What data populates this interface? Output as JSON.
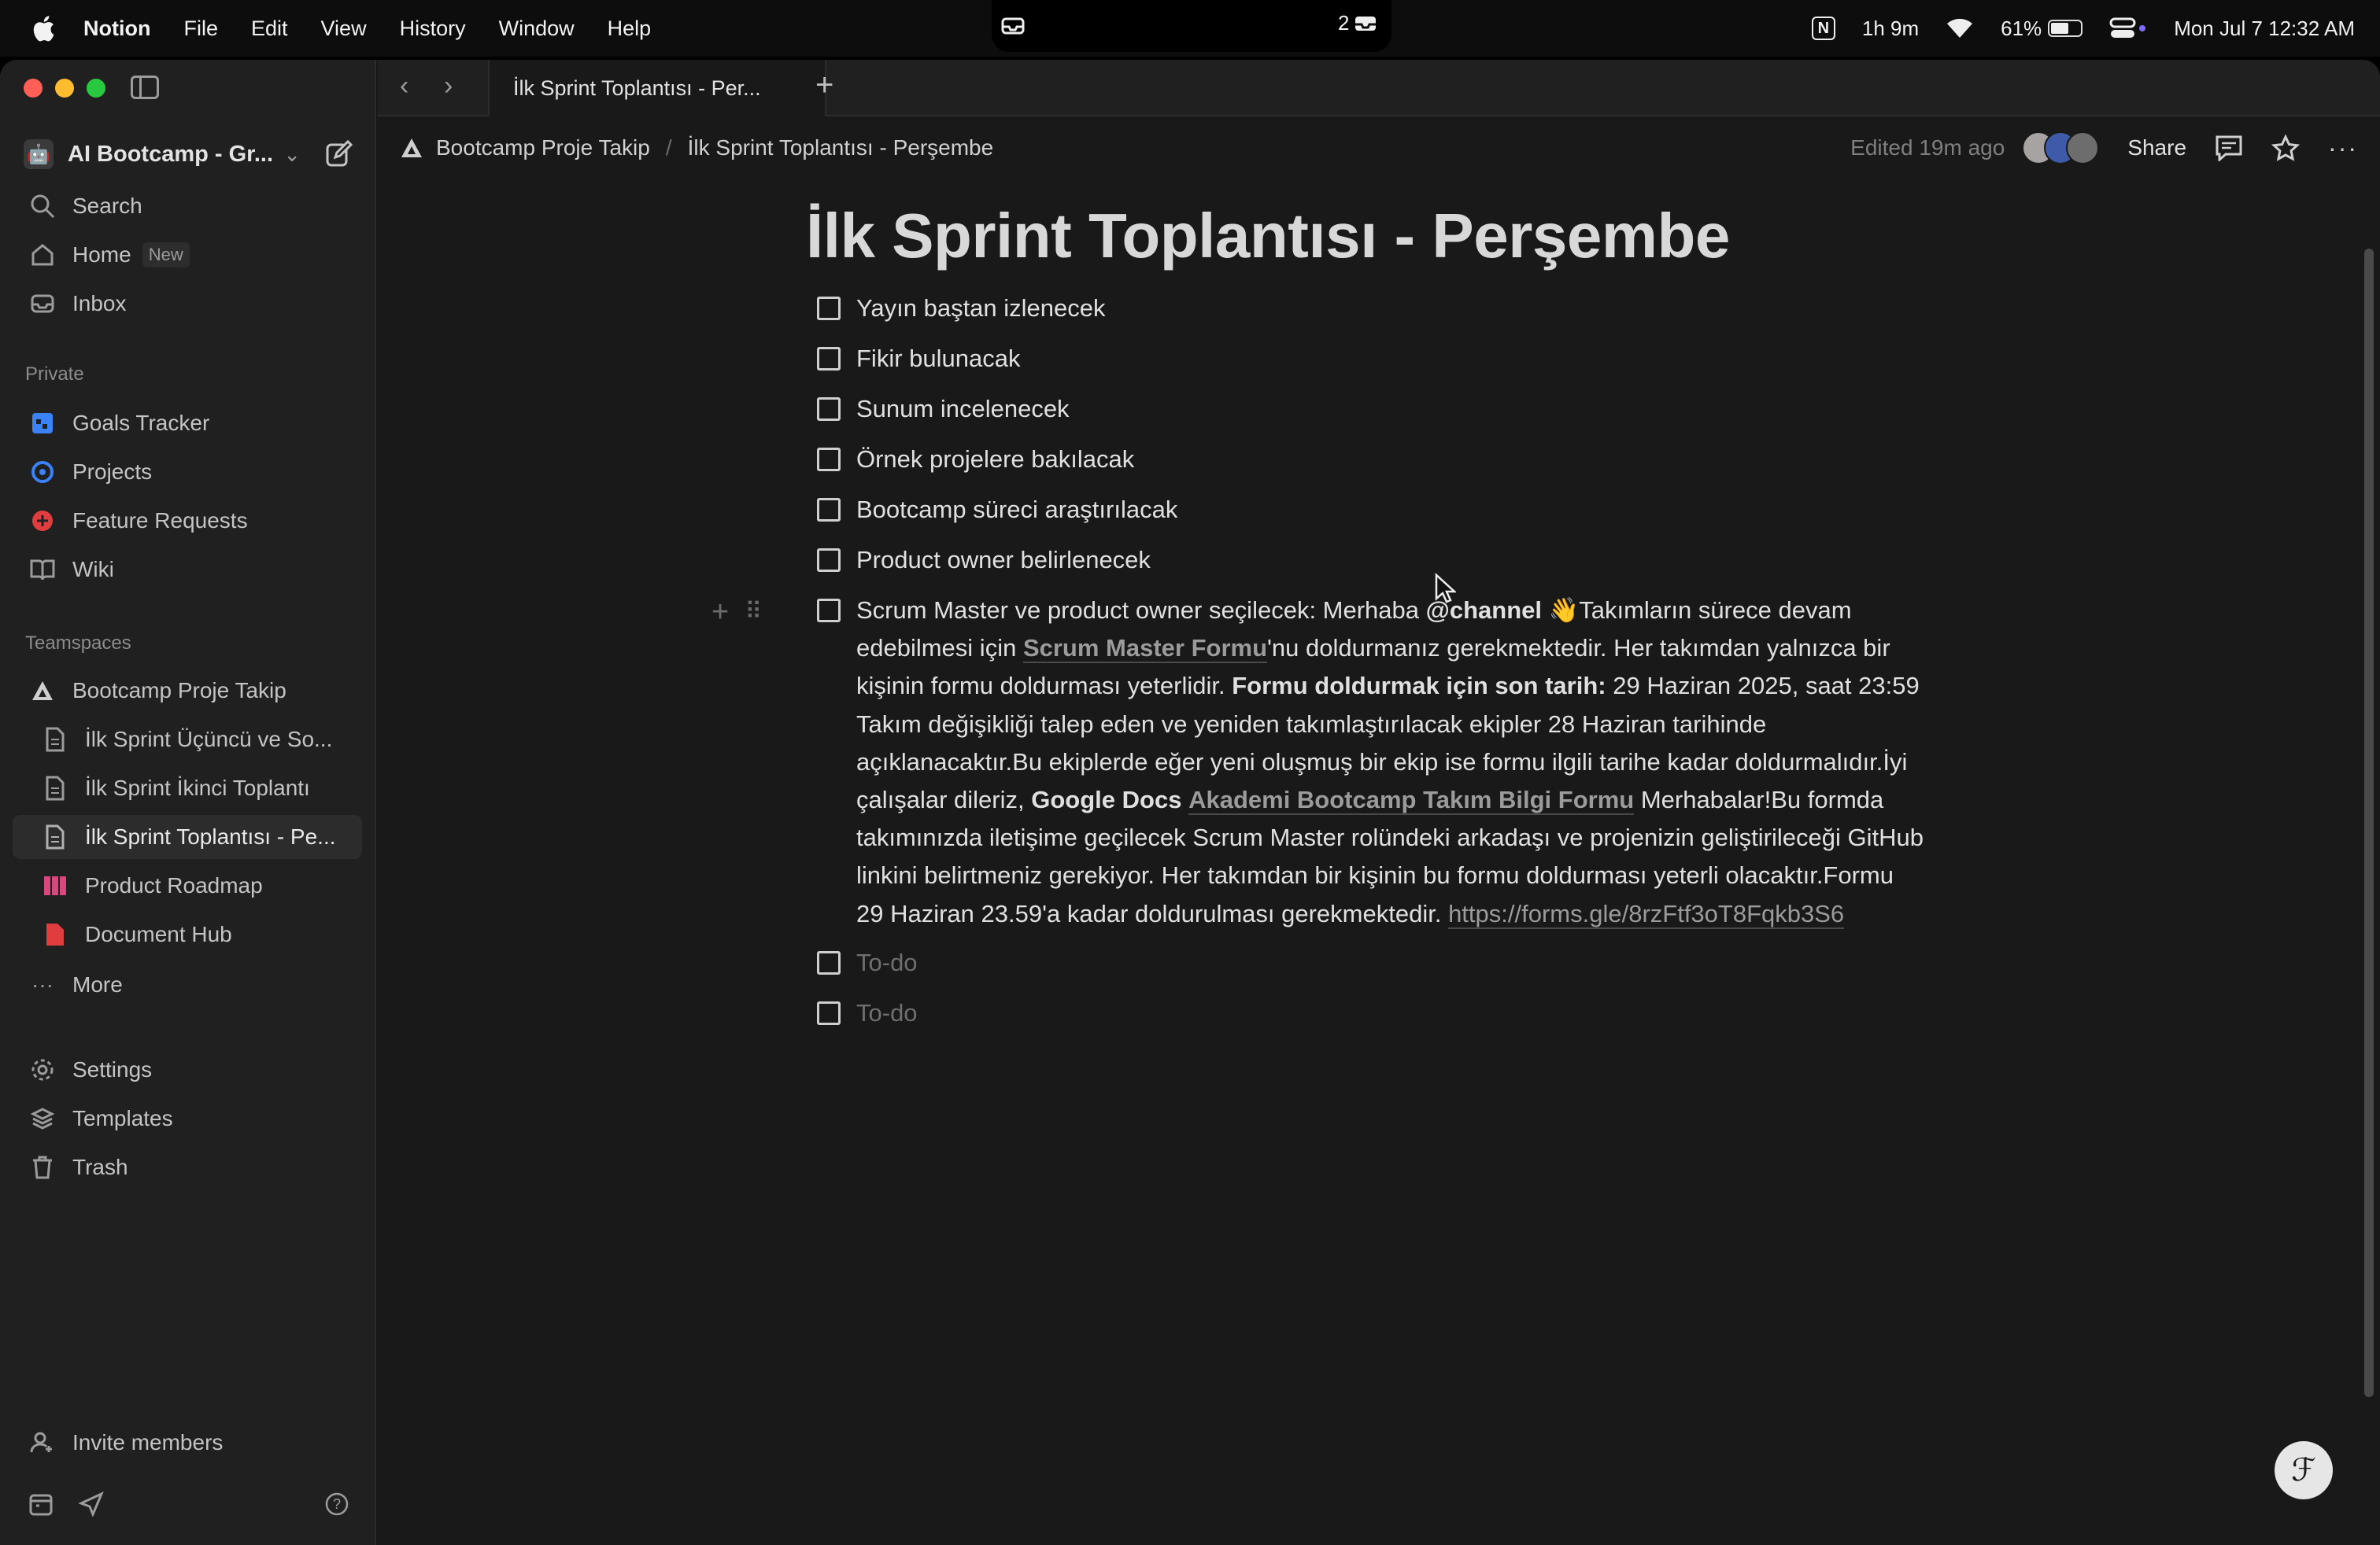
{
  "menubar": {
    "app": "Notion",
    "items": [
      "File",
      "Edit",
      "View",
      "History",
      "Window",
      "Help"
    ],
    "notch_count": "2",
    "timer": "1h 9m",
    "battery": "61%",
    "clock": "Mon Jul 7  12:32 AM"
  },
  "sidebar": {
    "workspace": "AI Bootcamp - Gr...",
    "search": "Search",
    "home": "Home",
    "home_badge": "New",
    "inbox": "Inbox",
    "private_heading": "Private",
    "private": [
      {
        "label": "Goals Tracker",
        "icon": "goals-icon",
        "color": "#3b82f6"
      },
      {
        "label": "Projects",
        "icon": "projects-icon",
        "color": "#3b82f6"
      },
      {
        "label": "Feature Requests",
        "icon": "feature-icon",
        "color": "#e03e3e"
      },
      {
        "label": "Wiki",
        "icon": "book-icon",
        "color": "#9b9b9b"
      }
    ],
    "teamspaces_heading": "Teamspaces",
    "teamspace": "Bootcamp Proje Takip",
    "pages": [
      {
        "label": "İlk Sprint Üçüncü ve So..."
      },
      {
        "label": "İlk Sprint İkinci Toplantı"
      },
      {
        "label": "İlk Sprint Toplantısı - Pe..."
      },
      {
        "label": "Product Roadmap"
      },
      {
        "label": "Document Hub"
      }
    ],
    "more": "More",
    "settings": "Settings",
    "templates": "Templates",
    "trash": "Trash",
    "invite": "Invite members"
  },
  "tab": {
    "title": "İlk Sprint Toplantısı - Per..."
  },
  "header": {
    "crumb_1": "Bootcamp Proje Takip",
    "crumb_2": "İlk Sprint Toplantısı - Perşembe",
    "edited": "Edited 19m ago",
    "share": "Share"
  },
  "page": {
    "title": "İlk Sprint Toplantısı - Perşembe",
    "todos": [
      "Yayın baştan izlenecek",
      "Fikir bulunacak",
      "Sunum incelenecek",
      "Örnek projelere bakılacak",
      "Bootcamp süreci araştırılacak",
      "Product owner belirlenecek"
    ],
    "long_todo": {
      "p1": "Scrum Master ve product owner seçilecek: Merhaba ",
      "mention": "@channel",
      "p2": " 👋Takımların sürece devam edebilmesi için ",
      "link1": "Scrum Master Formu",
      "p3": "'nu doldurmanız gerekmektedir. Her takımdan yalnızca bir kişinin formu doldurması yeterlidir. ",
      "bold1": "Formu doldurmak için son tarih:",
      "p4": " 29 Haziran 2025, saat 23:59 Takım değişikliği talep eden ve yeniden takımlaştırılacak ekipler 28 Haziran tarihinde açıklanacaktır.Bu ekiplerde eğer yeni oluşmuş bir ekip ise formu ilgili tarihe kadar doldurmalıdır.İyi çalışalar dileriz, ",
      "bold2": "Google Docs",
      "link2": "Akademi Bootcamp Takım Bilgi Formu",
      "p5": " Merhabalar!Bu formda takımınızda iletişime geçilecek Scrum Master rolündeki arkadaşı ve projenizin geliştirileceği GitHub linkini belirtmeniz gerekiyor. Her takımdan bir kişinin bu formu doldurması yeterli olacaktır.Formu 29 Haziran 23.59'a kadar doldurulması gerekmektedir. ",
      "url": "https://forms.gle/8rzFtf3oT8Fqkb3S6"
    },
    "placeholders": [
      "To-do",
      "To-do"
    ]
  }
}
